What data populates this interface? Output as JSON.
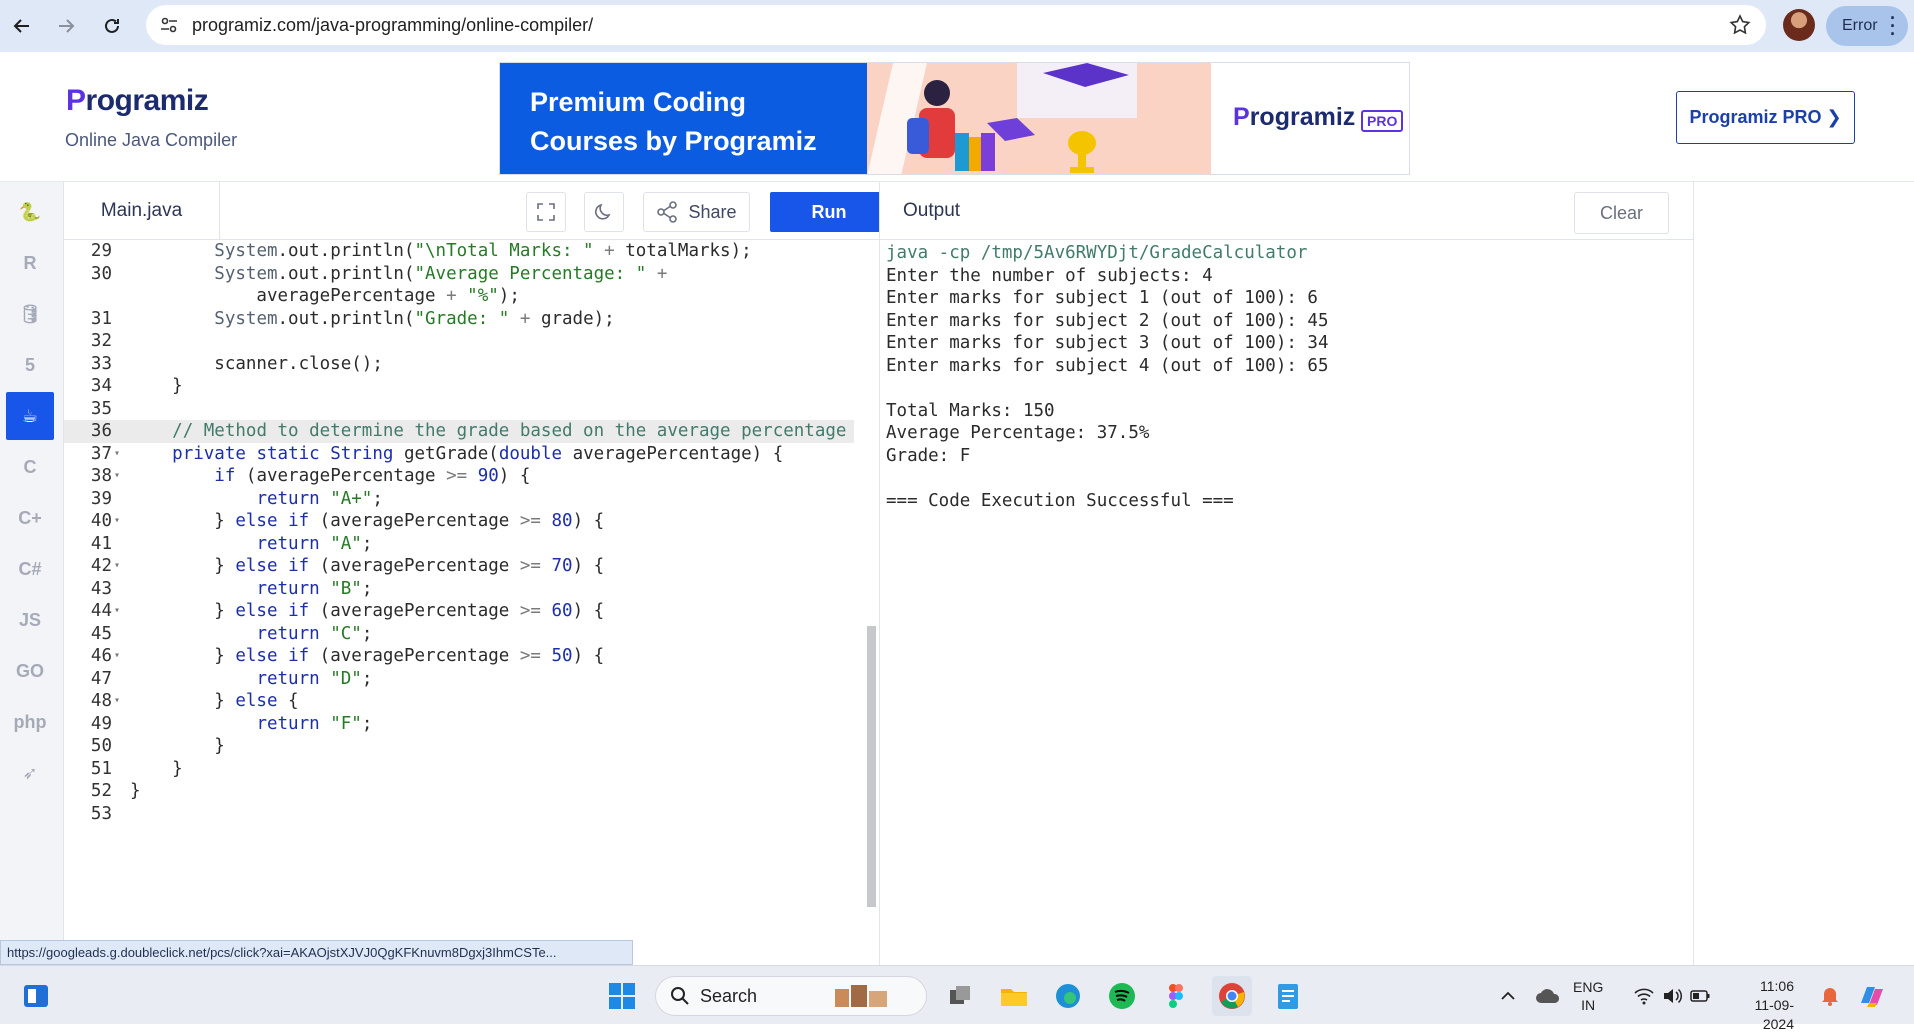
{
  "browser": {
    "url": "programiz.com/java-programming/online-compiler/",
    "profile_status": "Error"
  },
  "site": {
    "logo": "Programiz",
    "subtitle": "Online Java Compiler",
    "banner_title": "Premium Coding Courses by Programiz",
    "banner_logo": "Programiz",
    "banner_badge": "PRO",
    "pro_button": "Programiz PRO ❯"
  },
  "languages": [
    {
      "icon": "python-icon",
      "glyph": "🐍"
    },
    {
      "icon": "r-icon",
      "glyph": "R"
    },
    {
      "icon": "sql-icon",
      "glyph": "🛢"
    },
    {
      "icon": "html5-icon",
      "glyph": "5"
    },
    {
      "icon": "java-icon",
      "glyph": "☕",
      "active": true
    },
    {
      "icon": "c-icon",
      "glyph": "C"
    },
    {
      "icon": "cpp-icon",
      "glyph": "C+"
    },
    {
      "icon": "csharp-icon",
      "glyph": "C#"
    },
    {
      "icon": "javascript-icon",
      "glyph": "JS"
    },
    {
      "icon": "go-icon",
      "glyph": "GO"
    },
    {
      "icon": "php-icon",
      "glyph": "php"
    },
    {
      "icon": "swift-icon",
      "glyph": "➶"
    }
  ],
  "editor": {
    "filename": "Main.java",
    "share_label": "Share",
    "run_label": "Run",
    "lines": [
      {
        "n": "29",
        "fold": false,
        "html": "        <span class=\"obj\">System</span>.out.println(<span class=\"str\">\"\\nTotal Marks: \"</span> <span class=\"op\">+</span> totalMarks);"
      },
      {
        "n": "30",
        "fold": false,
        "html": "        <span class=\"obj\">System</span>.out.println(<span class=\"str\">\"Average Percentage: \"</span> <span class=\"op\">+</span>"
      },
      {
        "n": "",
        "fold": false,
        "html": "            averagePercentage <span class=\"op\">+</span> <span class=\"str\">\"%\"</span>);"
      },
      {
        "n": "31",
        "fold": false,
        "html": "        <span class=\"obj\">System</span>.out.println(<span class=\"str\">\"Grade: \"</span> <span class=\"op\">+</span> grade);"
      },
      {
        "n": "32",
        "fold": false,
        "html": ""
      },
      {
        "n": "33",
        "fold": false,
        "html": "        scanner.close();"
      },
      {
        "n": "34",
        "fold": false,
        "html": "    }"
      },
      {
        "n": "35",
        "fold": false,
        "html": ""
      },
      {
        "n": "36",
        "fold": false,
        "hl": true,
        "html": "    <span class=\"cm\">// Method to determine the grade based on the average percentage</span>"
      },
      {
        "n": "37",
        "fold": true,
        "html": "    <span class=\"kw\">private</span> <span class=\"kw\">static</span> <span class=\"kw\">String</span> getGrade(<span class=\"kw\">double</span> averagePercentage) {"
      },
      {
        "n": "38",
        "fold": true,
        "html": "        <span class=\"kw\">if</span> (averagePercentage <span class=\"op\">&gt;=</span> <span class=\"num\">90</span>) {"
      },
      {
        "n": "39",
        "fold": false,
        "html": "            <span class=\"kw\">return</span> <span class=\"str\">\"A+\"</span>;"
      },
      {
        "n": "40",
        "fold": true,
        "html": "        } <span class=\"kw\">else</span> <span class=\"kw\">if</span> (averagePercentage <span class=\"op\">&gt;=</span> <span class=\"num\">80</span>) {"
      },
      {
        "n": "41",
        "fold": false,
        "html": "            <span class=\"kw\">return</span> <span class=\"str\">\"A\"</span>;"
      },
      {
        "n": "42",
        "fold": true,
        "html": "        } <span class=\"kw\">else</span> <span class=\"kw\">if</span> (averagePercentage <span class=\"op\">&gt;=</span> <span class=\"num\">70</span>) {"
      },
      {
        "n": "43",
        "fold": false,
        "html": "            <span class=\"kw\">return</span> <span class=\"str\">\"B\"</span>;"
      },
      {
        "n": "44",
        "fold": true,
        "html": "        } <span class=\"kw\">else</span> <span class=\"kw\">if</span> (averagePercentage <span class=\"op\">&gt;=</span> <span class=\"num\">60</span>) {"
      },
      {
        "n": "45",
        "fold": false,
        "html": "            <span class=\"kw\">return</span> <span class=\"str\">\"C\"</span>;"
      },
      {
        "n": "46",
        "fold": true,
        "html": "        } <span class=\"kw\">else</span> <span class=\"kw\">if</span> (averagePercentage <span class=\"op\">&gt;=</span> <span class=\"num\">50</span>) {"
      },
      {
        "n": "47",
        "fold": false,
        "html": "            <span class=\"kw\">return</span> <span class=\"str\">\"D\"</span>;"
      },
      {
        "n": "48",
        "fold": true,
        "html": "        } <span class=\"kw\">else</span> {"
      },
      {
        "n": "49",
        "fold": false,
        "html": "            <span class=\"kw\">return</span> <span class=\"str\">\"F\"</span>;"
      },
      {
        "n": "50",
        "fold": false,
        "html": "        }"
      },
      {
        "n": "51",
        "fold": false,
        "html": "    }"
      },
      {
        "n": "52",
        "fold": false,
        "html": "}"
      },
      {
        "n": "53",
        "fold": false,
        "html": ""
      }
    ]
  },
  "output": {
    "label": "Output",
    "clear_label": "Clear",
    "command": "java -cp /tmp/5Av6RWYDjt/GradeCalculator",
    "lines": [
      "Enter the number of subjects: 4",
      "Enter marks for subject 1 (out of 100): 6",
      "Enter marks for subject 2 (out of 100): 45",
      "Enter marks for subject 3 (out of 100): 34",
      "Enter marks for subject 4 (out of 100): 65",
      "",
      "Total Marks: 150",
      "Average Percentage: 37.5%",
      "Grade: F",
      "",
      "=== Code Execution Successful ==="
    ]
  },
  "status_url": "https://googleads.g.doubleclick.net/pcs/click?xai=AKAOjstXJVJ0QgKFKnuvm8Dgxj3IhmCSTe...",
  "taskbar": {
    "search_label": "Search",
    "language_line1": "ENG",
    "language_line2": "IN",
    "time": "11:06",
    "date": "11-09-2024"
  },
  "colors": {
    "accent": "#1756e8",
    "browser_bar": "#dfe8f6",
    "brand_purple": "#5b33e0"
  }
}
